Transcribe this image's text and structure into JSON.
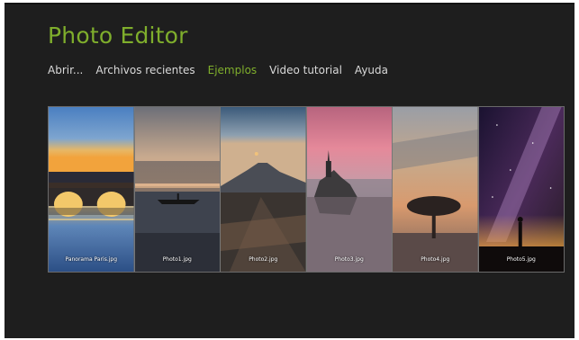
{
  "app": {
    "title": "Photo Editor"
  },
  "menu": {
    "items": [
      {
        "label": "Abrir..."
      },
      {
        "label": "Archivos recientes"
      },
      {
        "label": "Ejemplos",
        "active": true
      },
      {
        "label": "Video tutorial"
      },
      {
        "label": "Ayuda"
      }
    ]
  },
  "gallery": {
    "photos": [
      {
        "label": "Panorama Paris.jpg"
      },
      {
        "label": "Photo1.jpg"
      },
      {
        "label": "Photo2.jpg"
      },
      {
        "label": "Photo3.jpg"
      },
      {
        "label": "Photo4.jpg"
      },
      {
        "label": "Photo5.jpg"
      }
    ]
  },
  "colors": {
    "background": "#1e1e1e",
    "accent": "#7fae2c",
    "menu_text": "#d9d9d9"
  }
}
